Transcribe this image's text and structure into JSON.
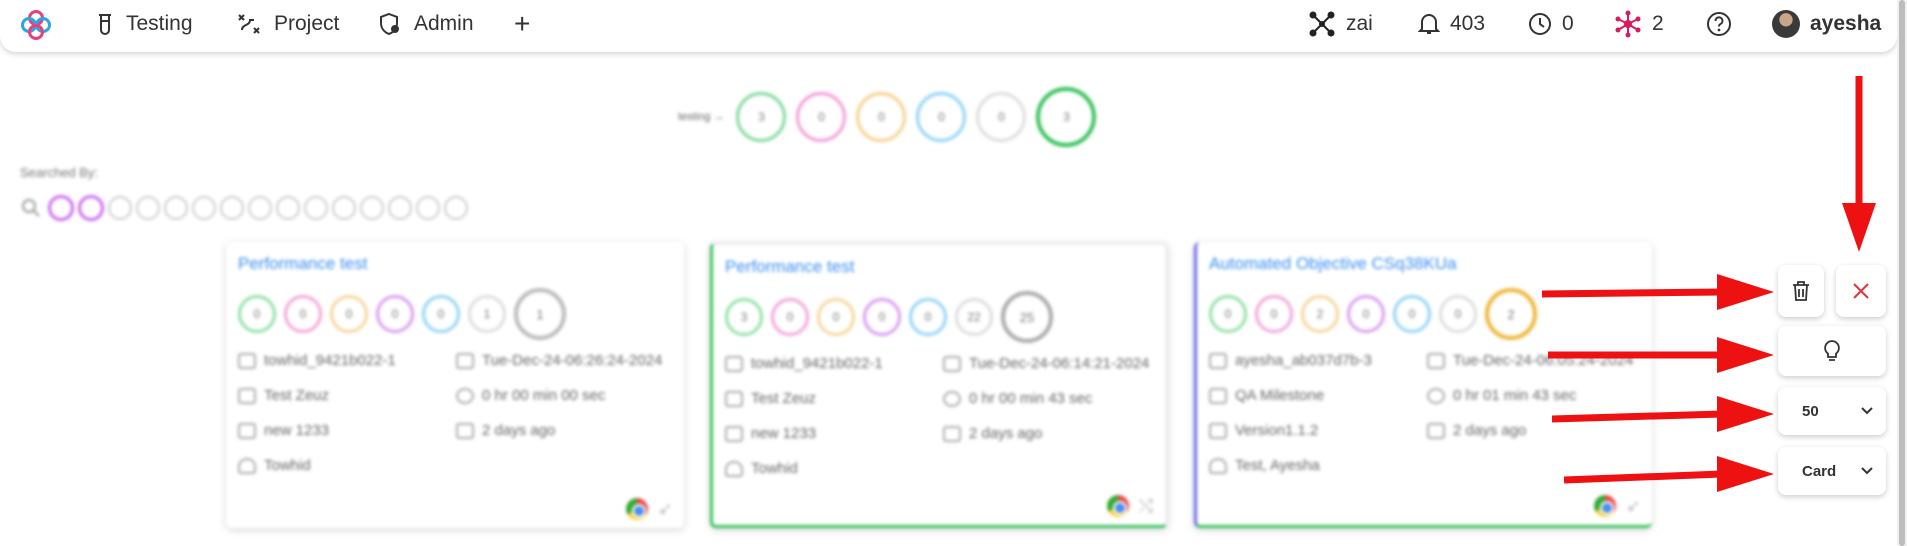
{
  "nav": {
    "testing": "Testing",
    "project": "Project",
    "admin": "Admin",
    "add": "+"
  },
  "header_right": {
    "workspace": "zai",
    "notifications": "403",
    "clock_count": "0",
    "network_count": "2",
    "username": "ayesha"
  },
  "summary": {
    "label": "testing →",
    "rings": [
      {
        "value": "3",
        "color": "#7ed99a"
      },
      {
        "value": "0",
        "color": "#f39ad6"
      },
      {
        "value": "0",
        "color": "#f7d08a"
      },
      {
        "value": "0",
        "color": "#8fd3f7"
      },
      {
        "value": "0",
        "color": "#dddddd"
      },
      {
        "value": "3",
        "color": "#35c15a"
      }
    ]
  },
  "searched_by": {
    "label": "Searched By:",
    "dot_colors": [
      "#c86af0",
      "#c86af0",
      "#cccccc",
      "#cccccc",
      "#cccccc",
      "#cccccc",
      "#cccccc",
      "#cccccc",
      "#cccccc",
      "#cccccc",
      "#cccccc",
      "#cccccc",
      "#cccccc",
      "#cccccc",
      "#cccccc"
    ]
  },
  "cards": [
    {
      "title": "Performance test",
      "accent": "#dddddd",
      "rings": [
        "0",
        "0",
        "0",
        "0",
        "0",
        "1"
      ],
      "total": "1",
      "total_color": "#bbbbbb",
      "user_id": "towhid_9421b022-1",
      "date": "Tue-Dec-24-06:26:24-2024",
      "milestone": "Test Zeuz",
      "duration": "0 hr 00 min 00 sec",
      "version": "new 1233",
      "ago": "2 days ago",
      "owner": "Towhid"
    },
    {
      "title": "Performance test",
      "accent": "#35c15a",
      "rings": [
        "3",
        "0",
        "0",
        "0",
        "0",
        "22"
      ],
      "total": "25",
      "total_color": "#aaaaaa",
      "user_id": "towhid_9421b022-1",
      "date": "Tue-Dec-24-06:14:21-2024",
      "milestone": "Test Zeuz",
      "duration": "0 hr 00 min 43 sec",
      "version": "new 1233",
      "ago": "2 days ago",
      "owner": "Towhid"
    },
    {
      "title": "Automated Objective CSq38KUa",
      "accent": "#6a6ae8",
      "rings": [
        "0",
        "0",
        "2",
        "0",
        "0",
        "0"
      ],
      "total": "2",
      "total_color": "#f0b63a",
      "user_id": "ayesha_ab037d7b-3",
      "date": "Tue-Dec-24-06:05:24-2024",
      "milestone": "QA Milestone",
      "duration": "0 hr 01 min 43 sec",
      "version": "Version1.1.2",
      "ago": "2 days ago",
      "owner": "Test, Ayesha"
    }
  ],
  "controls": {
    "page_size": "50",
    "view_mode": "Card"
  },
  "colors": {
    "annotation_arrow": "#ee1111",
    "link": "#3a8ef0",
    "close": "#e0353b"
  }
}
